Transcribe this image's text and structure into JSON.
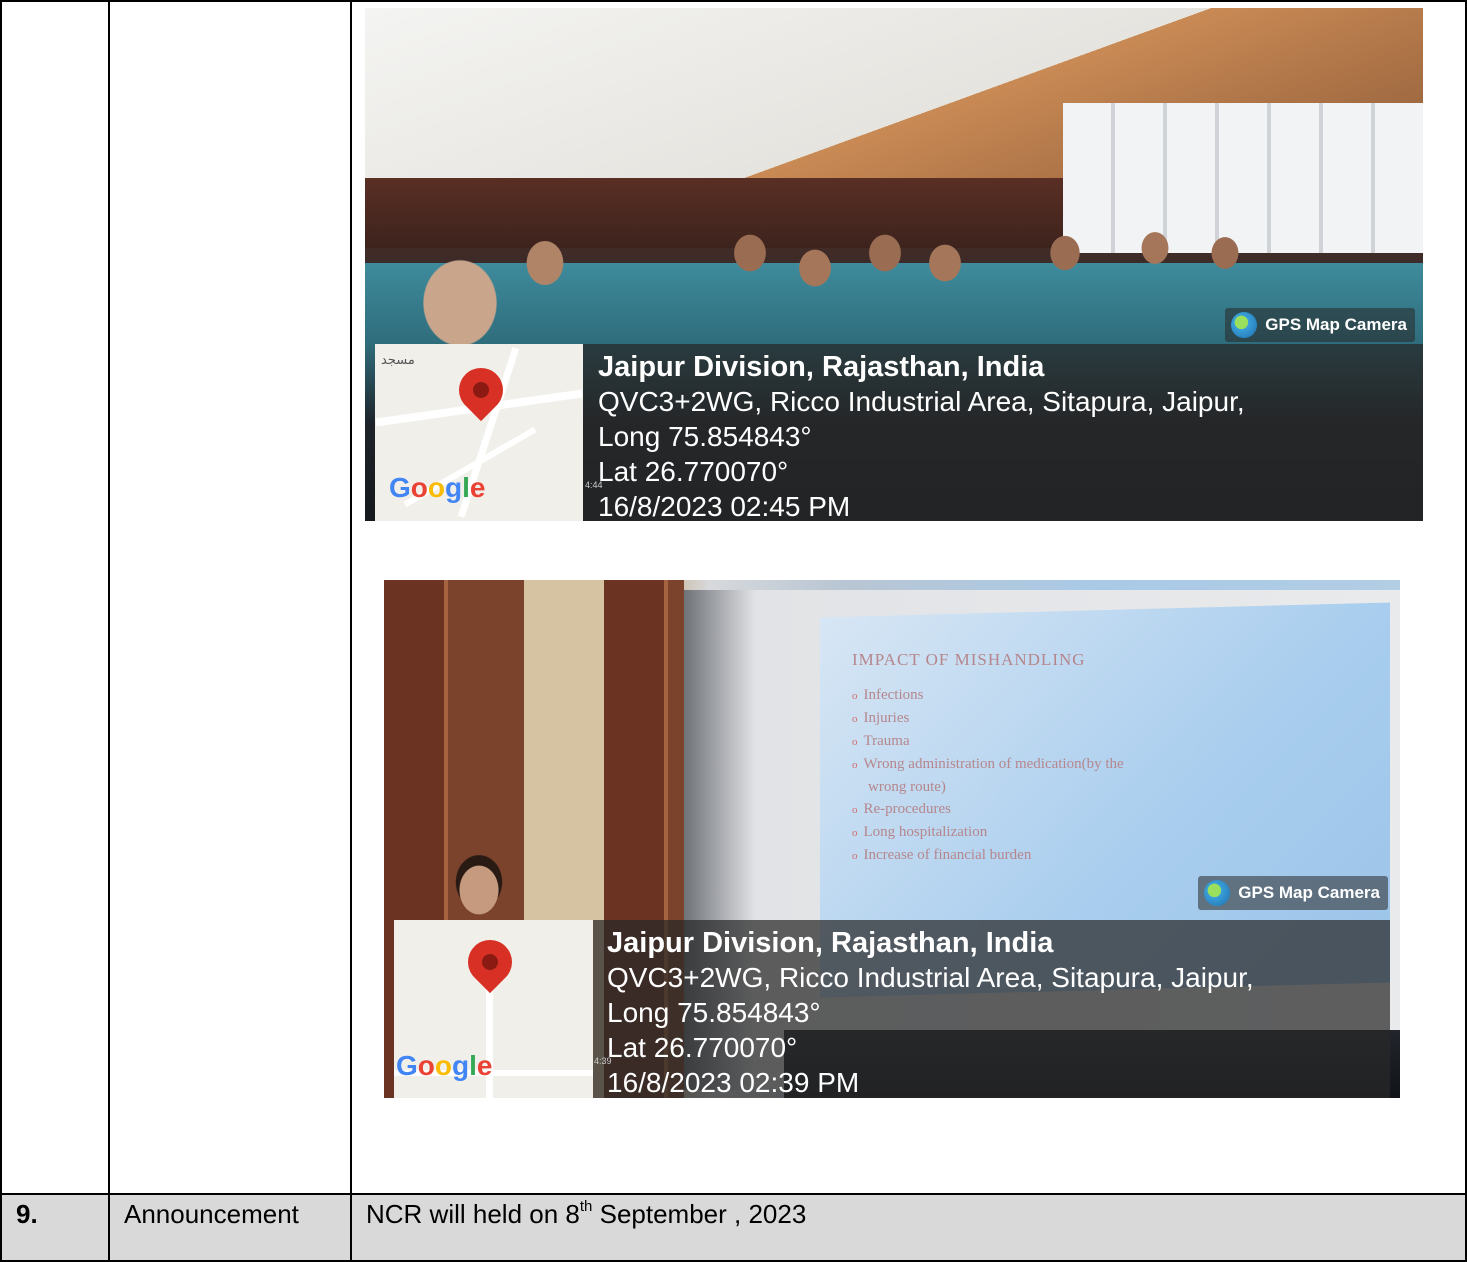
{
  "table": {
    "announcement_row": {
      "number": "9.",
      "label": "Announcement",
      "text_before": "NCR will held on  8",
      "text_sup": "th",
      "text_after": " September , 2023"
    }
  },
  "photos": [
    {
      "gps_badge": "GPS Map Camera",
      "location_title": "Jaipur Division, Rajasthan, India",
      "address": "QVC3+2WG, Ricco Industrial Area, Sitapura, Jaipur,",
      "long": "Long 75.854843°",
      "lat": "Lat 26.770070°",
      "datetime": "16/8/2023 02:45 PM",
      "map_brand": "Google",
      "map_label": "مسجد",
      "tiny_time": "4:44"
    },
    {
      "gps_badge": "GPS Map Camera",
      "location_title": "Jaipur Division, Rajasthan, India",
      "address": "QVC3+2WG, Ricco Industrial Area, Sitapura, Jaipur,",
      "long": "Long 75.854843°",
      "lat": "Lat 26.770070°",
      "datetime": "16/8/2023 02:39 PM",
      "map_brand": "Google",
      "tiny_time": "4:39",
      "slide": {
        "title": "IMPACT OF MISHANDLING",
        "items": [
          "Infections",
          "Injuries",
          "Trauma",
          "Wrong administration of medication(by  the",
          "wrong route)",
          "Re-procedures",
          "Long hospitalization",
          "Increase of financial burden"
        ]
      }
    }
  ]
}
